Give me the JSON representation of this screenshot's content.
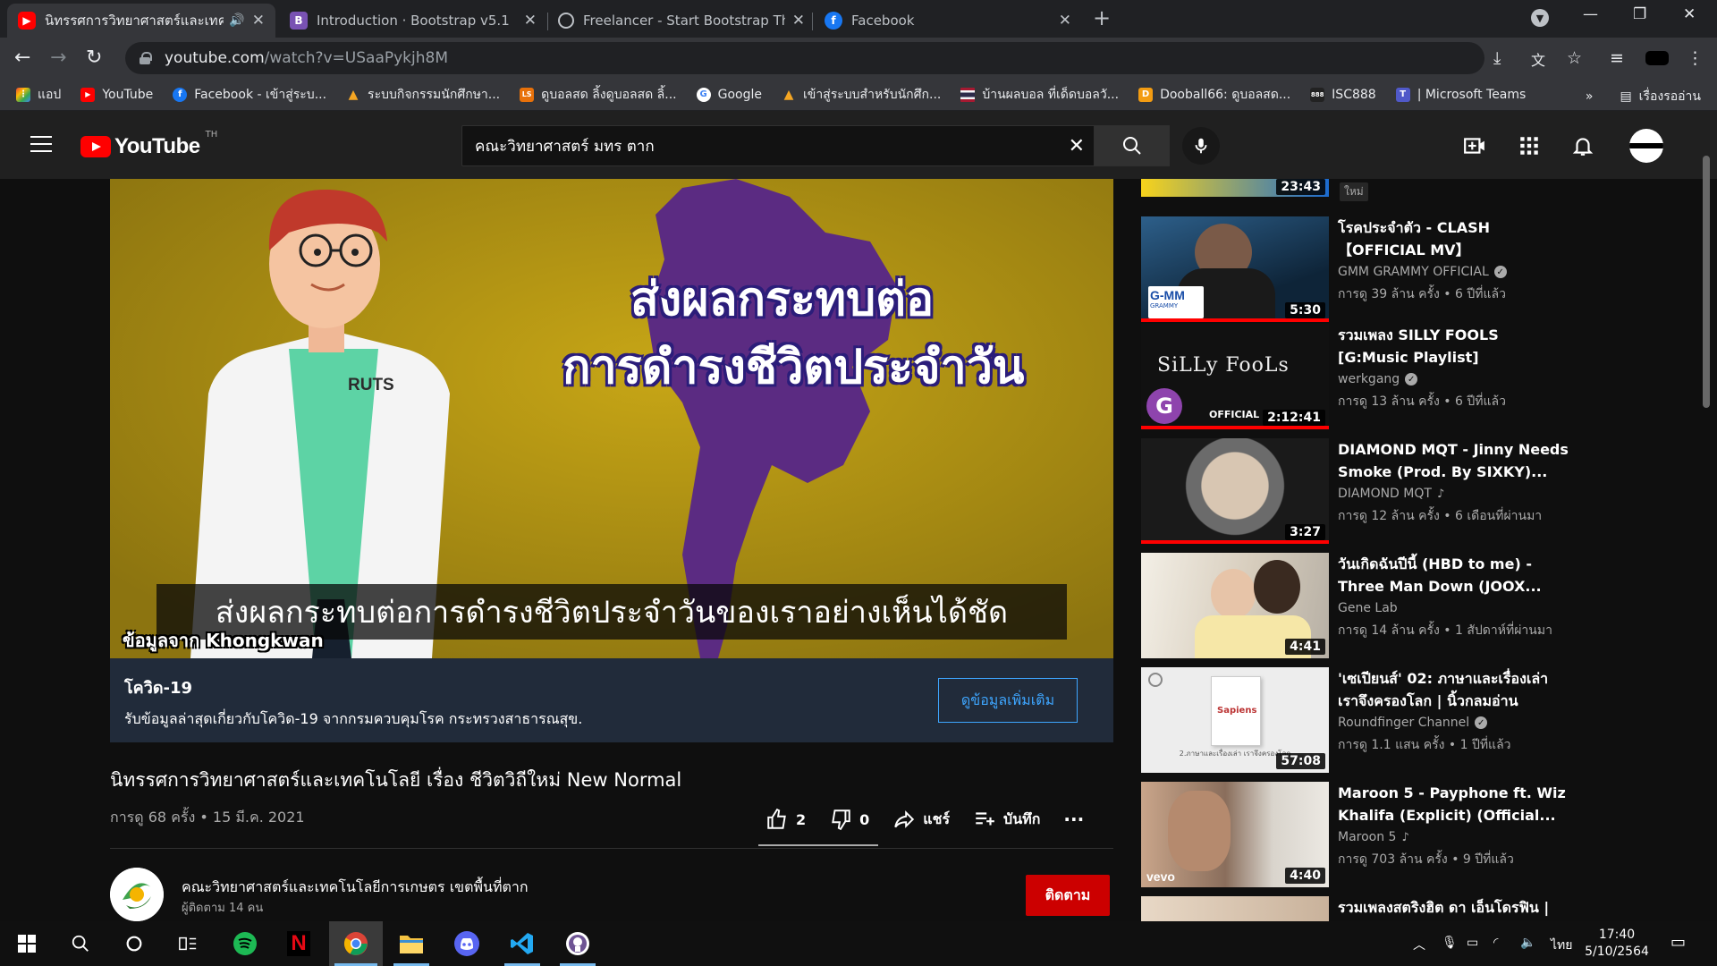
{
  "browser": {
    "tabs": [
      {
        "title": "นิทรรศการวิทยาศาสตร์และเทคโนโลยี เรื่อง ชีวิตวิถีใหม่",
        "favicon": "youtube-icon",
        "active": true
      },
      {
        "title": "Introduction · Bootstrap v5.1",
        "favicon": "bootstrap-icon"
      },
      {
        "title": "Freelancer - Start Bootstrap Theme",
        "favicon": "globe-icon"
      },
      {
        "title": "Facebook",
        "favicon": "facebook-icon"
      }
    ],
    "url_host": "youtube.com",
    "url_path": "/watch?v=USaaPykjh8M",
    "bookmarks": [
      {
        "label": "แอป",
        "icon": "apps-grid-icon"
      },
      {
        "label": "YouTube",
        "icon": "youtube-icon"
      },
      {
        "label": "Facebook - เข้าสู่ระบ...",
        "icon": "facebook-icon"
      },
      {
        "label": "ระบบกิจกรรมนักศึกษา...",
        "icon": "flame-icon"
      },
      {
        "label": "ดูบอลสด ลิ้งดูบอลสด ลิ้...",
        "icon": "ball-site-icon"
      },
      {
        "label": "Google",
        "icon": "google-icon"
      },
      {
        "label": "เข้าสู่ระบบสำหรับนักศึก...",
        "icon": "flame-icon"
      },
      {
        "label": "บ้านผลบอล ที่เด็ดบอลวั...",
        "icon": "thai-flag-icon"
      },
      {
        "label": "Dooball66: ดูบอลสด...",
        "icon": "dooball-icon"
      },
      {
        "label": "ISC888",
        "icon": "isc-icon"
      },
      {
        "label": "| Microsoft Teams",
        "icon": "teams-icon"
      }
    ],
    "reading_list": "เรื่องรออ่าน"
  },
  "youtube": {
    "logo_text": "YouTube",
    "country_code": "TH",
    "search_query": "คณะวิทยาศาสตร์ มทร ตาก"
  },
  "player": {
    "headline_line1": "ส่งผลกระทบต่อ",
    "headline_line2": "การดำรงชีวิตประจำวัน",
    "subtitle": "ส่งผลกระทบต่อการดำรงชีวิตประจำวันของเราอย่างเห็นได้ชัด",
    "credit": "ข้อมูลจาก Khongkwan",
    "coat_logo": "RUTS"
  },
  "info_panel": {
    "title": "โควิด-19",
    "text": "รับข้อมูลล่าสุดเกี่ยวกับโควิด-19 จากกรมควบคุมโรค กระทรวงสาธารณสุข.",
    "button": "ดูข้อมูลเพิ่มเติม"
  },
  "video": {
    "title": "นิทรรศการวิทยาศาสตร์และเทคโนโลยี เรื่อง ชีวิตวิถีใหม่ New Normal",
    "meta": "การดู 68 ครั้ง • 15 มี.ค. 2021",
    "likes": "2",
    "dislikes": "0",
    "share": "แชร์",
    "save": "บันทึก",
    "more": "···"
  },
  "channel": {
    "name": "คณะวิทยาศาสตร์และเทคโนโลยีการเกษตร เขตพื้นที่ตาก",
    "subs": "ผู้ติดตาม 14 คน",
    "subscribe": "ติดตาม"
  },
  "sidebar": {
    "partial_top": {
      "duration": "23:43",
      "badge": "ใหม่"
    },
    "items": [
      {
        "title": "โรคประจำตัว - CLASH 【OFFICIAL MV】",
        "channel": "GMM GRAMMY OFFICIAL",
        "verified": true,
        "views": "การดู 39 ล้าน ครั้ง • 6 ปีที่แล้ว",
        "duration": "5:30",
        "watched": 1.0
      },
      {
        "title": "รวมเพลง SILLY FOOLS [G:Music Playlist]",
        "channel": "werkgang",
        "verified": true,
        "views": "การดู 13 ล้าน ครั้ง • 6 ปีที่แล้ว",
        "duration": "2:12:41",
        "watched": 1.0
      },
      {
        "title": "DIAMOND MQT - Jinny Needs Smoke (Prod. By SIXKY)...",
        "channel": "DIAMOND MQT",
        "music": true,
        "views": "การดู 12 ล้าน ครั้ง • 6 เดือนที่ผ่านมา",
        "duration": "3:27",
        "watched": 1.0
      },
      {
        "title": "วันเกิดฉันปีนี้ (HBD to me) - Three Man Down (JOOX...",
        "channel": "Gene Lab",
        "views": "การดู 14 ล้าน ครั้ง • 1 สัปดาห์ที่ผ่านมา",
        "duration": "4:41",
        "watched": 0
      },
      {
        "title": "'เซเปียนส์' 02: ภาษาและเรื่องเล่า เราจึงครองโลก | นิ้วกลมอ่าน",
        "channel": "Roundfinger Channel",
        "verified": true,
        "views": "การดู 1.1 แสน ครั้ง • 1 ปีที่แล้ว",
        "duration": "57:08",
        "watched": 0
      },
      {
        "title": "Maroon 5 - Payphone ft. Wiz Khalifa (Explicit) (Official...",
        "channel": "Maroon 5",
        "music": true,
        "views": "การดู 703 ล้าน ครั้ง • 9 ปีที่แล้ว",
        "duration": "4:40",
        "watched": 0
      }
    ],
    "partial_bottom_title": "รวมเพลงสตริงฮิต ดา เอ็นโดรฟิน |"
  },
  "thumb_texts": {
    "gmm": "G-MM",
    "gmm_sub": "GRAMMY",
    "silly": "SiLLy FooLs",
    "official": "OFFICIAL",
    "sapiens": "Sapiens",
    "sapiens_caption": "2.ภาษาและเรื่องเล่า เราจึงครองโลก",
    "vevo": "vevo"
  },
  "taskbar": {
    "lang": "ไทย",
    "time": "17:40",
    "date": "5/10/2564"
  },
  "colors": {
    "youtube_red": "#ff0000",
    "subscribe_red": "#cc0000",
    "link_blue": "#3ea6ff",
    "player_gold": "#b89a14",
    "map_purple": "#5b2b82"
  }
}
